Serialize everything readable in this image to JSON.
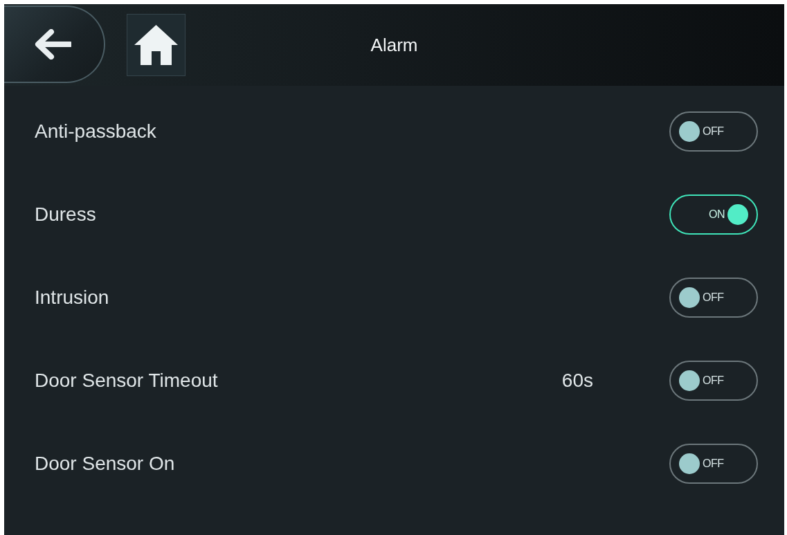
{
  "header": {
    "title": "Alarm"
  },
  "settings": [
    {
      "label": "Anti-passback",
      "on": false,
      "state_text": "OFF"
    },
    {
      "label": "Duress",
      "on": true,
      "state_text": "ON"
    },
    {
      "label": "Intrusion",
      "on": false,
      "state_text": "OFF"
    },
    {
      "label": "Door Sensor Timeout",
      "value": "60s",
      "on": false,
      "state_text": "OFF"
    },
    {
      "label": "Door Sensor On",
      "on": false,
      "state_text": "OFF"
    }
  ]
}
